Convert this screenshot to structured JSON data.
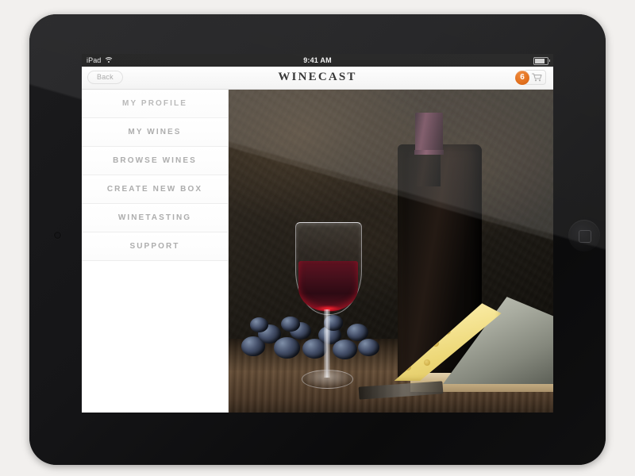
{
  "device": {
    "name": "iPad",
    "home_button": "home-button",
    "camera": "front-camera"
  },
  "status_bar": {
    "carrier": "iPad",
    "wifi_icon": "wifi-icon",
    "time": "9:41 AM",
    "battery_icon": "battery-icon"
  },
  "nav_bar": {
    "back_label": "Back",
    "app_title": "WINECAST",
    "cart_badge_count": "6",
    "cart_icon": "shopping-cart-icon",
    "accent_color": "#e2701e"
  },
  "sidebar": {
    "items": [
      {
        "label": "MY PROFILE"
      },
      {
        "label": "MY WINES"
      },
      {
        "label": "BROWSE WINES"
      },
      {
        "label": "CREATE NEW BOX"
      },
      {
        "label": "WINETASTING"
      },
      {
        "label": "SUPPORT"
      }
    ]
  },
  "main": {
    "hero_photo": "wine-bottle-glass-cheese-photo"
  }
}
